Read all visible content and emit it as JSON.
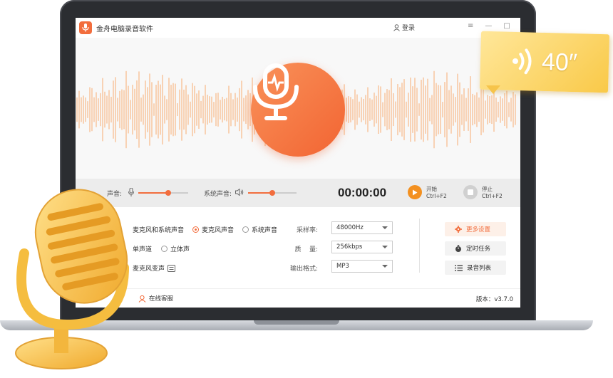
{
  "app": {
    "title": "金舟电脑录音软件",
    "login_label": "登录",
    "window_controls": [
      "≡",
      "—",
      "□",
      "✕"
    ]
  },
  "recorder": {
    "mic_volume_label": "麦克风声音:",
    "mic_volume_label_visible": "声音:",
    "system_volume_label": "系统声音:",
    "mic_volume": 0.6,
    "system_volume": 0.5,
    "timer": "00:00:00",
    "start": {
      "label": "开始",
      "shortcut": "Ctrl+F2"
    },
    "stop": {
      "label": "停止",
      "shortcut": "Ctrl+F2"
    }
  },
  "settings": {
    "source_options": [
      {
        "label": "麦克风和系统声音",
        "selected": false
      },
      {
        "label": "麦克风声音",
        "selected": true
      },
      {
        "label": "系统声音",
        "selected": false
      }
    ],
    "channel_options": [
      {
        "label": "单声道",
        "selected": true
      },
      {
        "label": "立体声",
        "selected": false
      }
    ],
    "voice_changer_label": "麦克风变声",
    "sample_rate_label": "采样率:",
    "sample_rate_value": "48000Hz",
    "quality_label": "质    量:",
    "quality_value": "256kbps",
    "format_label": "输出格式:",
    "format_value": "MP3",
    "more_settings": "更多设置",
    "scheduled_task": "定时任务",
    "record_list": "录音列表"
  },
  "footer": {
    "service": "在线客服",
    "version": "版本：v3.7.0"
  },
  "badge": {
    "duration": "40″"
  },
  "colors": {
    "accent": "#f26d3d",
    "wave": "#f9b988",
    "start": "#f39020",
    "badge": "#f9c948"
  }
}
